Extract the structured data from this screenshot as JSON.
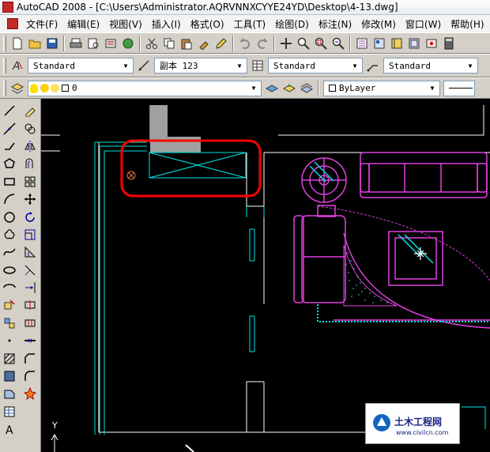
{
  "window": {
    "title": "AutoCAD 2008 - [C:\\Users\\Administrator.AQRVNNXCYYE24YD\\Desktop\\4-13.dwg]"
  },
  "menu": [
    "文件(F)",
    "编辑(E)",
    "视图(V)",
    "插入(I)",
    "格式(O)",
    "工具(T)",
    "绘图(D)",
    "标注(N)",
    "修改(M)",
    "窗口(W)",
    "帮助(H)"
  ],
  "styles": {
    "text_style": "Standard",
    "dim_style": "副本 123",
    "table_style": "Standard",
    "multileader_style": "Standard"
  },
  "layers": {
    "current_layer": "0",
    "color": "ByLayer"
  },
  "canvas": {
    "ucs_y_label": "Y",
    "colors": {
      "background": "#000000",
      "cyan": "#00e5e5",
      "magenta": "#e040e0",
      "white": "#ffffff",
      "red_highlight": "#ff0000",
      "gray_fill": "#a0a0a0"
    }
  },
  "watermark": {
    "title": "土木工程网",
    "url": "www.civilcn.com"
  }
}
